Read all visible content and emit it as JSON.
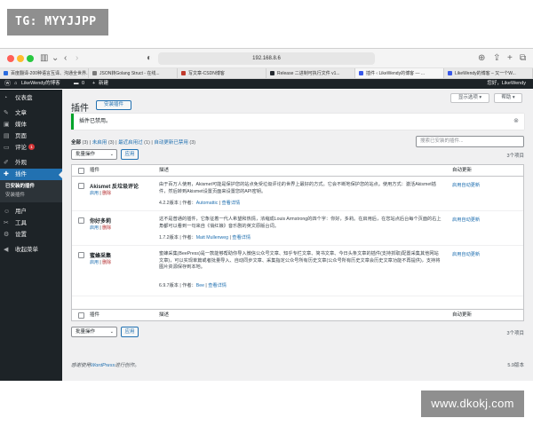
{
  "watermarks": {
    "top": "TG: MYYJJPP",
    "bottom": "www.dkokj.com"
  },
  "browser": {
    "url": "192.168.8.6",
    "tabs": [
      {
        "label": "百度翻译-200种语言互译、沟通全世界...",
        "color": "#2b6de0"
      },
      {
        "label": "JSON转Golang Struct - 在线...",
        "color": "#7a7a7a"
      },
      {
        "label": "写文章-CSDN博客",
        "color": "#c0392b"
      },
      {
        "label": "Release 二进制可执行文件 v1...",
        "color": "#24292f"
      },
      {
        "label": "插件 ‹ LikeWendy的博客 — ...",
        "color": "#3858e9"
      },
      {
        "label": "LikeWendy的博客 – 又一个W...",
        "color": "#3858e9"
      }
    ],
    "active_tab": 4
  },
  "adminbar": {
    "site_name": "LikeWendy的博客",
    "comments_count": "0",
    "new_label": "新建",
    "greeting": "您好，LikeWendy"
  },
  "sidebar": {
    "items": [
      {
        "label": "仪表盘",
        "icon": "dashboard-icon",
        "glyph": "◔"
      },
      {
        "label": "文章",
        "icon": "pin-icon",
        "glyph": "✎"
      },
      {
        "label": "媒体",
        "icon": "media-icon",
        "glyph": "▣"
      },
      {
        "label": "页面",
        "icon": "page-icon",
        "glyph": "▤"
      },
      {
        "label": "评论",
        "icon": "comment-icon",
        "glyph": "▭",
        "badge": "1"
      },
      {
        "label": "外观",
        "icon": "brush-icon",
        "glyph": "✐"
      },
      {
        "label": "插件",
        "icon": "plugin-icon",
        "glyph": "✚"
      },
      {
        "label": "用户",
        "icon": "user-icon",
        "glyph": "☺"
      },
      {
        "label": "工具",
        "icon": "tools-icon",
        "glyph": "✂"
      },
      {
        "label": "设置",
        "icon": "settings-icon",
        "glyph": "⚙"
      },
      {
        "label": "收起菜单",
        "icon": "collapse-icon",
        "glyph": "◀"
      }
    ],
    "sub_items": [
      "已安装的插件",
      "安装插件"
    ]
  },
  "screen_options": "显示选项 ▾",
  "help": "帮助 ▾",
  "page": {
    "title": "插件",
    "add_new": "安装插件",
    "notice": "插件已禁用。",
    "filters": {
      "all": "全部",
      "all_count": "(3)",
      "inactive": "未启用",
      "inactive_count": "(3)",
      "recent": "最近启用过",
      "recent_count": "(1)",
      "auto_disabled": "自动更新已禁用",
      "auto_disabled_count": "(3)"
    },
    "search_placeholder": "搜索已安装的插件...",
    "bulk_label": "批量操作",
    "apply": "应用",
    "item_count": "3个项目",
    "columns": {
      "plugin": "插件",
      "description": "描述",
      "auto_update": "自动更新"
    },
    "plugins": [
      {
        "name": "Akismet 反垃圾评论",
        "enable": "启用",
        "delete": "删除",
        "desc1": "由于百万人使用，Akismet可能是保护您的站点免受垃圾评论的世界上最好的方式。它会不断地保护您的站点。使用方式：激活Akismet插件，然后转到Akismet设置页面来设置您的API密钥。",
        "version": "4.2.2版本",
        "author_label": "作者：",
        "author": "Automattic",
        "details": "查看详情",
        "auto": "启用自动更新"
      },
      {
        "name": "你好多莉",
        "enable": "启用",
        "delete": "删除",
        "desc1": "这不是普通的插件，它象征着一代人希望和热情，浓缩成Louis Armstrong的四个字：你好，多莉。在启用后，在您站点后台每个页面的右上角都可以看到一句来自《俏红娘》音乐剧的英文原版台词。",
        "version": "1.7.2版本",
        "author_label": "作者：",
        "author": "Matt Mullenweg",
        "details": "查看详情",
        "auto": "启用自动更新"
      },
      {
        "name": "蜜蜂采集",
        "enable": "启用",
        "delete": "删除",
        "desc1": "蜜蜂采集(BeePress)是一款能够帮助你导入微信公众号文章、知乎专栏文章、简书文章、今日头条文章的插件(支持抓取)配置采集其他网站文章)，可以实现单篇或者批量导入、自动同步文章、采集指定公众号所有历史文章(公众号所有历史文章会历史文章功能不再提供)，支持将图片资源保存到本地。",
        "version": "6.9.7版本",
        "author_label": "作者：",
        "author": "Bee",
        "details": "查看详情",
        "auto": "启用自动更新"
      }
    ],
    "footer_prefix": "感谢使用",
    "footer_link": "WordPress",
    "footer_suffix": "进行创作。",
    "version": "5.9版本"
  }
}
